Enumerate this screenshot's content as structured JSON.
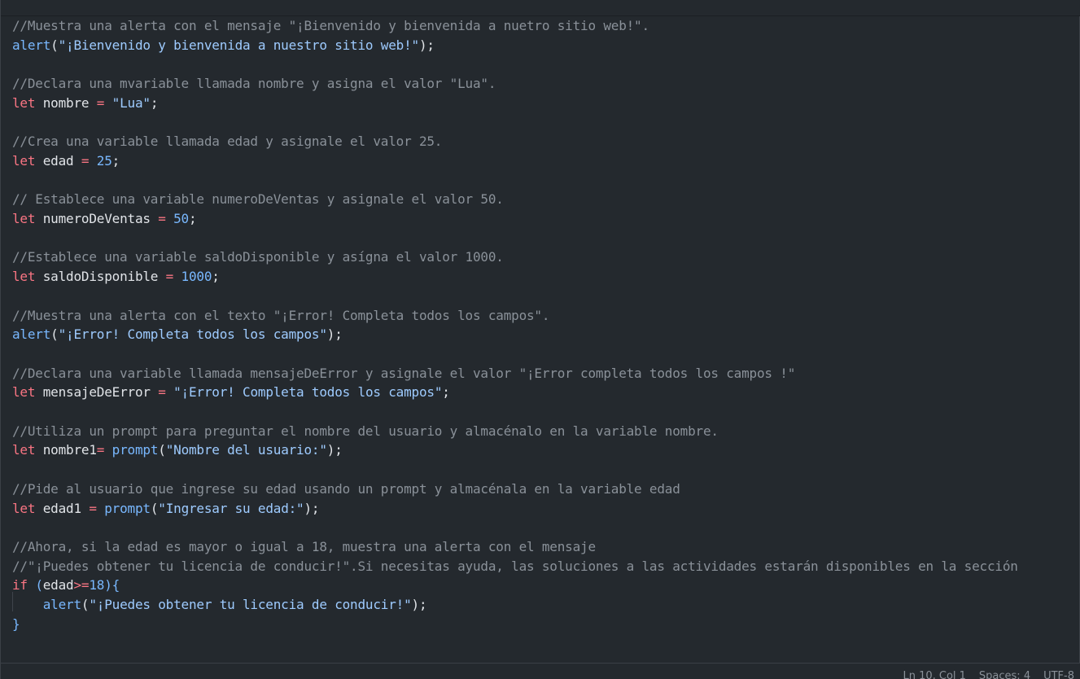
{
  "code_lines": [
    {
      "parts": [
        {
          "t": "comment",
          "v": "//Muestra una alerta con el mensaje \"¡Bienvenido y bienvenida a nuetro sitio web!\"."
        }
      ]
    },
    {
      "parts": [
        {
          "t": "fn",
          "v": "alert"
        },
        {
          "t": "punc",
          "v": "("
        },
        {
          "t": "str",
          "v": "\"¡Bienvenido y bienvenida a nuestro sitio web!\""
        },
        {
          "t": "punc",
          "v": ");"
        }
      ]
    },
    {
      "parts": []
    },
    {
      "parts": [
        {
          "t": "comment",
          "v": "//Declara una mvariable llamada nombre y asigna el valor \"Lua\"."
        }
      ]
    },
    {
      "parts": [
        {
          "t": "keyword",
          "v": "let"
        },
        {
          "t": "ident",
          "v": " nombre "
        },
        {
          "t": "op",
          "v": "="
        },
        {
          "t": "ident",
          "v": " "
        },
        {
          "t": "str",
          "v": "\"Lua\""
        },
        {
          "t": "punc",
          "v": ";"
        }
      ]
    },
    {
      "parts": []
    },
    {
      "parts": [
        {
          "t": "comment",
          "v": "//Crea una variable llamada edad y asignale el valor 25."
        }
      ]
    },
    {
      "parts": [
        {
          "t": "keyword",
          "v": "let"
        },
        {
          "t": "ident",
          "v": " edad "
        },
        {
          "t": "op",
          "v": "="
        },
        {
          "t": "ident",
          "v": " "
        },
        {
          "t": "num",
          "v": "25"
        },
        {
          "t": "punc",
          "v": ";"
        }
      ]
    },
    {
      "parts": []
    },
    {
      "parts": [
        {
          "t": "comment",
          "v": "// Establece una variable numeroDeVentas y asignale el valor 50."
        }
      ]
    },
    {
      "parts": [
        {
          "t": "keyword",
          "v": "let"
        },
        {
          "t": "ident",
          "v": " numeroDeVentas "
        },
        {
          "t": "op",
          "v": "="
        },
        {
          "t": "ident",
          "v": " "
        },
        {
          "t": "num",
          "v": "50"
        },
        {
          "t": "punc",
          "v": ";"
        }
      ]
    },
    {
      "parts": []
    },
    {
      "parts": [
        {
          "t": "comment",
          "v": "//Establece una variable saldoDisponible y asígna el valor 1000."
        }
      ]
    },
    {
      "parts": [
        {
          "t": "keyword",
          "v": "let"
        },
        {
          "t": "ident",
          "v": " saldoDisponible "
        },
        {
          "t": "op",
          "v": "="
        },
        {
          "t": "ident",
          "v": " "
        },
        {
          "t": "num",
          "v": "1000"
        },
        {
          "t": "punc",
          "v": ";"
        }
      ]
    },
    {
      "parts": []
    },
    {
      "parts": [
        {
          "t": "comment",
          "v": "//Muestra una alerta con el texto \"¡Error! Completa todos los campos\"."
        }
      ]
    },
    {
      "parts": [
        {
          "t": "fn",
          "v": "alert"
        },
        {
          "t": "punc",
          "v": "("
        },
        {
          "t": "str",
          "v": "\"¡Error! Completa todos los campos\""
        },
        {
          "t": "punc",
          "v": ");"
        }
      ]
    },
    {
      "parts": []
    },
    {
      "parts": [
        {
          "t": "comment",
          "v": "//Declara una variable llamada mensajeDeError y asignale el valor \"¡Error completa todos los campos !\""
        }
      ]
    },
    {
      "parts": [
        {
          "t": "keyword",
          "v": "let"
        },
        {
          "t": "ident",
          "v": " mensajeDeError "
        },
        {
          "t": "op",
          "v": "="
        },
        {
          "t": "ident",
          "v": " "
        },
        {
          "t": "str",
          "v": "\"¡Error! Completa todos los campos\""
        },
        {
          "t": "punc",
          "v": ";"
        }
      ]
    },
    {
      "parts": []
    },
    {
      "parts": [
        {
          "t": "comment",
          "v": "//Utiliza un prompt para preguntar el nombre del usuario y almacénalo en la variable nombre."
        }
      ]
    },
    {
      "parts": [
        {
          "t": "keyword",
          "v": "let"
        },
        {
          "t": "ident",
          "v": " nombre1"
        },
        {
          "t": "op",
          "v": "="
        },
        {
          "t": "ident",
          "v": " "
        },
        {
          "t": "fn",
          "v": "prompt"
        },
        {
          "t": "punc",
          "v": "("
        },
        {
          "t": "str",
          "v": "\"Nombre del usuario:\""
        },
        {
          "t": "punc",
          "v": ");"
        }
      ]
    },
    {
      "parts": []
    },
    {
      "parts": [
        {
          "t": "comment",
          "v": "//Pide al usuario que ingrese su edad usando un prompt y almacénala en la variable edad"
        }
      ]
    },
    {
      "parts": [
        {
          "t": "keyword",
          "v": "let"
        },
        {
          "t": "ident",
          "v": " edad1 "
        },
        {
          "t": "op",
          "v": "="
        },
        {
          "t": "ident",
          "v": " "
        },
        {
          "t": "fn",
          "v": "prompt"
        },
        {
          "t": "punc",
          "v": "("
        },
        {
          "t": "str",
          "v": "\"Ingresar su edad:\""
        },
        {
          "t": "punc",
          "v": ");"
        }
      ]
    },
    {
      "parts": []
    },
    {
      "parts": [
        {
          "t": "comment",
          "v": "//Ahora, si la edad es mayor o igual a 18, muestra una alerta con el mensaje"
        }
      ]
    },
    {
      "parts": [
        {
          "t": "comment",
          "v": "//\"¡Puedes obtener tu licencia de conducir!\".Si necesitas ayuda, las soluciones a las actividades estarán disponibles en la sección"
        }
      ]
    },
    {
      "parts": [
        {
          "t": "keyword",
          "v": "if"
        },
        {
          "t": "ident",
          "v": " "
        },
        {
          "t": "brace",
          "v": "("
        },
        {
          "t": "ident",
          "v": "edad"
        },
        {
          "t": "op",
          "v": ">="
        },
        {
          "t": "num",
          "v": "18"
        },
        {
          "t": "brace",
          "v": "){"
        }
      ]
    },
    {
      "parts": [
        {
          "t": "ident",
          "v": "    "
        },
        {
          "t": "fn",
          "v": "alert"
        },
        {
          "t": "punc",
          "v": "("
        },
        {
          "t": "str",
          "v": "\"¡Puedes obtener tu licencia de conducir!\""
        },
        {
          "t": "punc",
          "v": ");"
        }
      ]
    },
    {
      "parts": [
        {
          "t": "brace",
          "v": "}"
        }
      ]
    }
  ],
  "status_bar": {
    "position": "Ln 10, Col 1",
    "spaces": "Spaces: 4",
    "encoding": "UTF-8"
  },
  "colors": {
    "background": "#24292e",
    "comment": "#8a9199",
    "keyword": "#f97583",
    "string": "#9ecbff",
    "function": "#79b8ff"
  }
}
